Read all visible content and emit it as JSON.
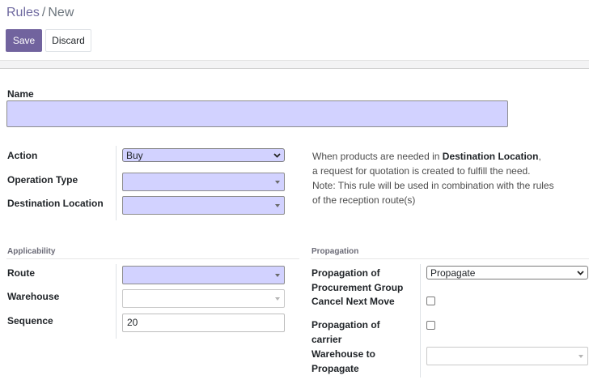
{
  "breadcrumb": {
    "parent": "Rules",
    "separator": "/",
    "current": "New"
  },
  "toolbar": {
    "save_label": "Save",
    "discard_label": "Discard"
  },
  "form": {
    "name": {
      "label": "Name",
      "value": ""
    },
    "action": {
      "label": "Action",
      "value": "Buy"
    },
    "operation_type": {
      "label": "Operation Type",
      "value": ""
    },
    "destination_location": {
      "label": "Destination Location",
      "value": ""
    },
    "note": {
      "line1_pre": "When products are needed in ",
      "line1_bold": "Destination Location",
      "line1_post": ",",
      "line2": "a request for quotation is created to fulfill the need.",
      "line3": "Note: This rule will be used in combination with the rules",
      "line4": "of the reception route(s)"
    },
    "applicability": {
      "title": "Applicability",
      "route": {
        "label": "Route",
        "value": ""
      },
      "warehouse": {
        "label": "Warehouse",
        "value": ""
      },
      "sequence": {
        "label": "Sequence",
        "value": "20"
      }
    },
    "propagation": {
      "title": "Propagation",
      "procurement_group": {
        "label_line1": "Propagation of",
        "label_line2": "Procurement Group",
        "value": "Propagate"
      },
      "cancel_next_move": {
        "label": "Cancel Next Move",
        "checked": false
      },
      "carrier": {
        "label_line1": "Propagation of",
        "label_line2": "carrier",
        "checked": false
      },
      "warehouse_to_propagate": {
        "label_line1": "Warehouse to",
        "label_line2": "Propagate",
        "value": ""
      }
    }
  },
  "colors": {
    "primary": "#71639e",
    "required_field": "#d2d2ff"
  }
}
